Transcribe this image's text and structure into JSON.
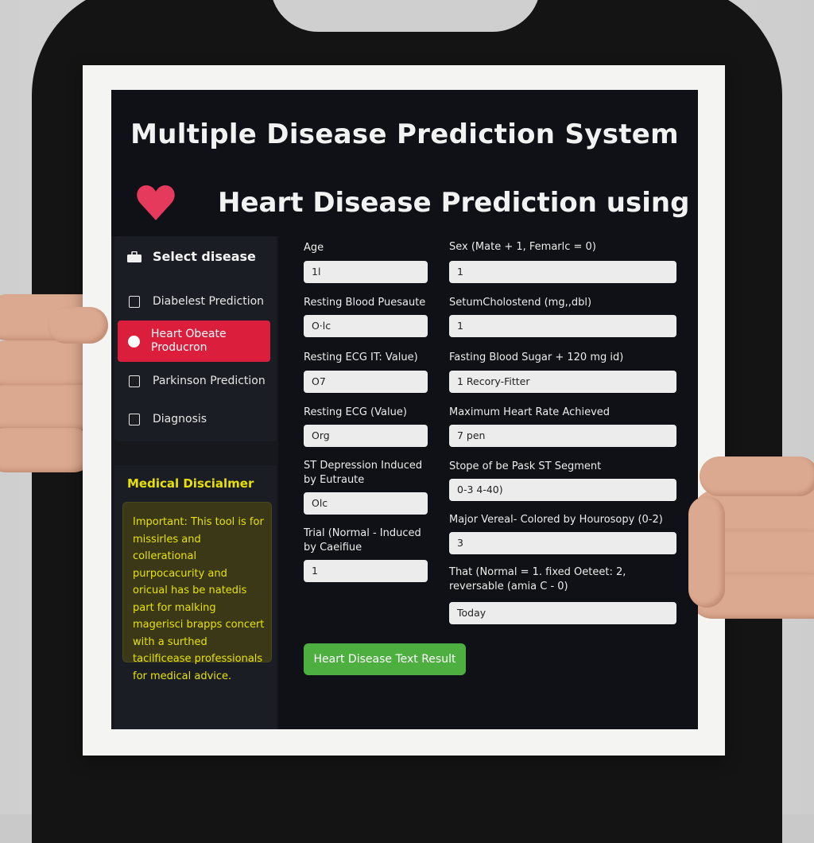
{
  "app": {
    "title": "Multiple Disease Prediction System",
    "subtitle": "Heart Disease Prediction using ML"
  },
  "sidebar": {
    "header": "Select disease",
    "items": [
      {
        "label": "Diabelest Prediction",
        "active": false
      },
      {
        "label": "Heart Obeate Producron",
        "active": true
      },
      {
        "label": "Parkinson Prediction",
        "active": false
      },
      {
        "label": "Diagnosis",
        "active": false
      }
    ]
  },
  "disclaimer": {
    "title": "Medical Discialmer",
    "text": "Important: This tool is for missirles and collerational purpocacurity and oricual has be natedis part for malking magerisci brapps concert with a surthed tacilficease professionals for medical advice."
  },
  "form": {
    "left": [
      {
        "label": "Age",
        "value": "1l"
      },
      {
        "label": "Resting Blood Puesaute",
        "value": "O·lc"
      },
      {
        "label": "Resting ECG IT: Value)",
        "value": "O7"
      },
      {
        "label": "Resting ECG (Value)",
        "value": "Org"
      },
      {
        "label": "ST Depression Induced by Eutraute",
        "value": "Olc"
      },
      {
        "label": "Trial (Normal - Induced by Caeifiue",
        "value": "1"
      }
    ],
    "right": [
      {
        "label": "Sex (Mate + 1, Femarlc = 0)",
        "value": "1"
      },
      {
        "label": "SetumCholostend (mg,,dbl)",
        "value": "1"
      },
      {
        "label": "Fasting Blood Sugar + 120 mg id)",
        "value": "1  Recory-Fitter"
      },
      {
        "label": "Maximum Heart Rate Achieved",
        "value": "7   pen"
      },
      {
        "label": "Stope of be Pask ST Segment",
        "value": "0-3  4-40)"
      },
      {
        "label": "Major Vereal- Colored by Hourosopy (0-2)",
        "value": "3"
      },
      {
        "label": "That (Normal = 1. fixed Oeteet: 2, reversable (amia C - 0)",
        "value": "Today"
      }
    ],
    "submit_label": "Heart Disease Text Result"
  },
  "colors": {
    "accent_active": "#dc1e3d",
    "button": "#4caf3f",
    "disclaimer_text": "#e8e200",
    "screen_bg": "#0f1116"
  }
}
